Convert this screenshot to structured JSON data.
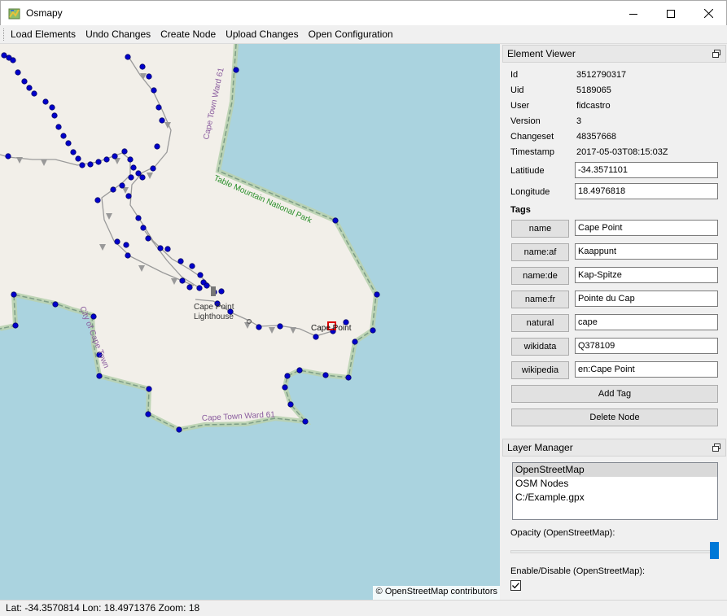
{
  "window": {
    "title": "Osmapy",
    "minimize_icon": "minimize-icon",
    "maximize_icon": "maximize-icon",
    "close_icon": "close-icon"
  },
  "menu": {
    "items": [
      "Load Elements",
      "Undo Changes",
      "Create Node",
      "Upload Changes",
      "Open Configuration"
    ]
  },
  "map": {
    "labels": {
      "ward_top": "Cape Town Ward 61",
      "park": "Table Mountain National Park",
      "city": "City of Cape Town",
      "lighthouse_1": "Cape Point",
      "lighthouse_2": "Lighthouse",
      "cape_point": "Cape Point",
      "ward_bottom": "Cape Town Ward 61"
    },
    "attribution": "© OpenStreetMap contributors",
    "colors": {
      "water": "#aad3df",
      "land": "#f2efe9",
      "park_border": "#b9d2b0",
      "node": "#0000cc",
      "selected_node": "#dd0000"
    }
  },
  "status": {
    "text": "Lat: -34.3570814 Lon: 18.4971376 Zoom: 18"
  },
  "element_viewer": {
    "title": "Element Viewer",
    "properties": [
      {
        "label": "Id",
        "value": "3512790317"
      },
      {
        "label": "Uid",
        "value": "5189065"
      },
      {
        "label": "User",
        "value": "fidcastro"
      },
      {
        "label": "Version",
        "value": "3"
      },
      {
        "label": "Changeset",
        "value": "48357668"
      },
      {
        "label": "Timestamp",
        "value": "2017-05-03T08:15:03Z"
      }
    ],
    "latitude_label": "Latitiude",
    "latitude_value": "-34.3571101",
    "longitude_label": "Longitude",
    "longitude_value": "18.4976818",
    "tags_heading": "Tags",
    "tags": [
      {
        "key": "name",
        "value": "Cape Point"
      },
      {
        "key": "name:af",
        "value": "Kaappunt"
      },
      {
        "key": "name:de",
        "value": "Kap-Spitze"
      },
      {
        "key": "name:fr",
        "value": "Pointe du Cap"
      },
      {
        "key": "natural",
        "value": "cape"
      },
      {
        "key": "wikidata",
        "value": "Q378109"
      },
      {
        "key": "wikipedia",
        "value": "en:Cape Point"
      }
    ],
    "add_tag_label": "Add Tag",
    "delete_node_label": "Delete Node"
  },
  "layer_manager": {
    "title": "Layer Manager",
    "layers": [
      "OpenStreetMap",
      "OSM Nodes",
      "C:/Example.gpx"
    ],
    "selected_layer": "OpenStreetMap",
    "opacity_label": "Opacity (OpenStreetMap):",
    "opacity": 1.0,
    "enable_label": "Enable/Disable (OpenStreetMap):",
    "enabled": true
  }
}
